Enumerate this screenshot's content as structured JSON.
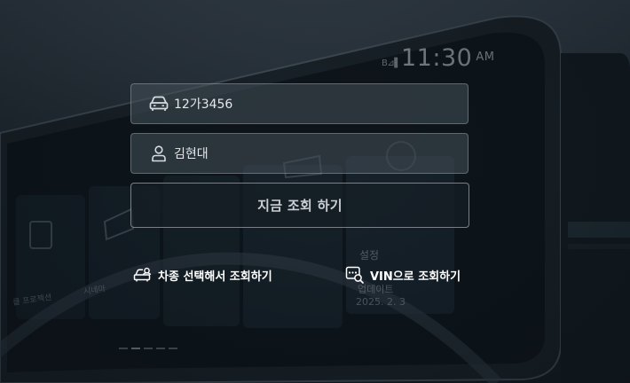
{
  "background": {
    "clock_time": "11:30",
    "clock_ampm": "AM",
    "status_text": "B⊿▌",
    "tile_settings_title": "설정",
    "tile_update_text": "업데이트",
    "tile_date_text": "2025. 2. 3",
    "tile_left_text_1": "클 프로젝션",
    "tile_left_text_2": "시네마"
  },
  "form": {
    "plate_value": "12가3456",
    "name_value": "김현대",
    "submit_label": "지금 조회 하기"
  },
  "links": {
    "model_label": "차종 선택해서 조회하기",
    "vin_label": "VIN으로 조회하기"
  },
  "colors": {
    "accent": "#ffffff",
    "field_bg": "#46505a",
    "page_bg": "#141c22"
  },
  "icons": {
    "plate": "car-icon",
    "name": "person-icon",
    "model": "car-select-icon",
    "vin": "vin-search-icon"
  }
}
